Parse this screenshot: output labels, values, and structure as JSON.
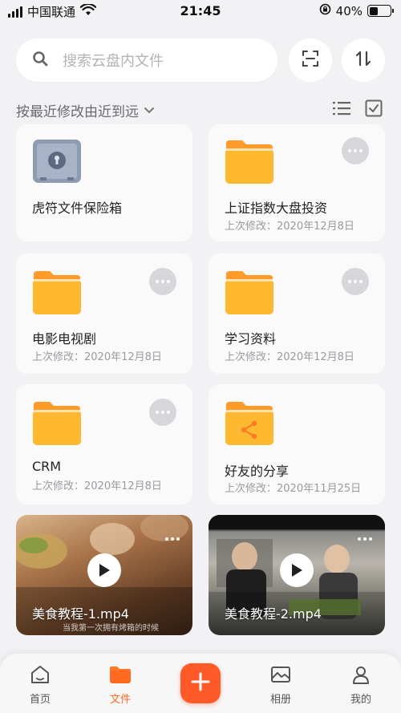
{
  "status_bar": {
    "carrier": "中国联通",
    "time": "21:45",
    "battery": "40%",
    "battery_level": 0.4
  },
  "search": {
    "placeholder": "搜索云盘内文件"
  },
  "toolbar": {
    "scan_icon": "scan-icon",
    "sort_icon": "sort-icon"
  },
  "sort": {
    "label": "按最近修改由近到远"
  },
  "files": [
    {
      "name": "虎符文件保险箱",
      "type": "vault",
      "meta": ""
    },
    {
      "name": "上证指数大盘投资",
      "type": "folder",
      "meta": "上次修改：2020年12月8日"
    },
    {
      "name": "电影电视剧",
      "type": "folder",
      "meta": "上次修改：2020年12月8日"
    },
    {
      "name": "学习资料",
      "type": "folder",
      "meta": "上次修改：2020年12月8日"
    },
    {
      "name": "CRM",
      "type": "folder",
      "meta": "上次修改：2020年12月8日"
    },
    {
      "name": "好友的分享",
      "type": "shared-folder",
      "meta": "上次修改：2020年11月25日"
    }
  ],
  "videos": [
    {
      "name": "美食教程-1.mp4",
      "caption": "当我第一次拥有烤箱的时候"
    },
    {
      "name": "美食教程-2.mp4",
      "caption": ""
    }
  ],
  "tabs": [
    {
      "label": "首页",
      "icon": "home-icon"
    },
    {
      "label": "文件",
      "icon": "folder-icon",
      "active": true
    },
    {
      "label": "相册",
      "icon": "photo-icon"
    },
    {
      "label": "我的",
      "icon": "user-icon"
    }
  ],
  "colors": {
    "accent": "#ff5a28",
    "folder": "#ffb930",
    "folder_tab": "#ff9a2b"
  }
}
